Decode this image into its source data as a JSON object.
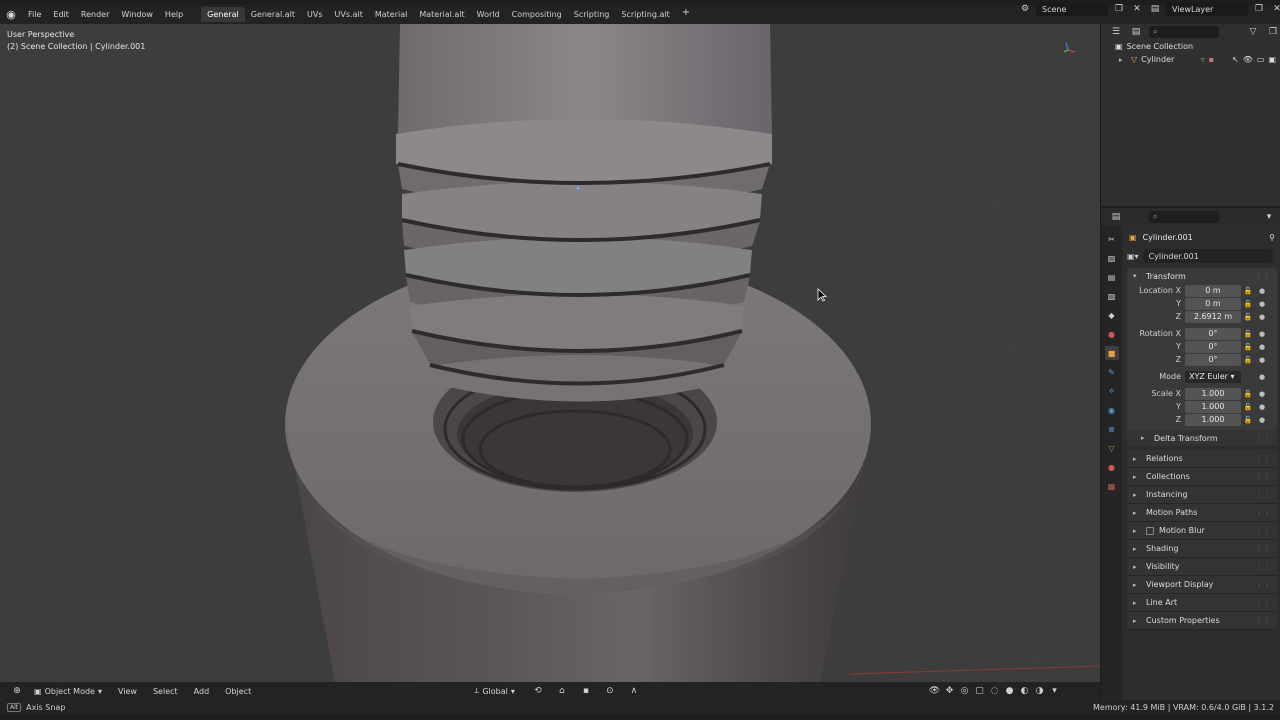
{
  "menu": [
    "File",
    "Edit",
    "Render",
    "Window",
    "Help"
  ],
  "tabs": [
    "General",
    "General.alt",
    "UVs",
    "UVs.alt",
    "Material",
    "Material.alt",
    "World",
    "Compositing",
    "Scripting",
    "Scripting.alt"
  ],
  "tab_add": "+",
  "scene": {
    "name": "Scene",
    "view_layer": "ViewLayer"
  },
  "viewport": {
    "perspective": "User Perspective",
    "collection": "(2) Scene Collection | Cylinder.001"
  },
  "footer": {
    "mode": "Object Mode",
    "menus": [
      "View",
      "Select",
      "Add",
      "Object"
    ],
    "orientation": "Global"
  },
  "status": {
    "key": "Alt",
    "hint": "Axis Snap",
    "memory": "Memory: 41.9 MiB | VRAM: 0.6/4.0 GiB | 3.1.2"
  },
  "outliner": {
    "collection": "Scene Collection",
    "object": "Cylinder"
  },
  "props": {
    "object_name": "Cylinder.001",
    "data_name": "Cylinder.001",
    "transform_title": "Transform",
    "location": {
      "label": "Location X",
      "x": "0 m",
      "y": "0 m",
      "z": "2.6912 m"
    },
    "rotation": {
      "label": "Rotation X",
      "x": "0°",
      "y": "0°",
      "z": "0°"
    },
    "mode": {
      "label": "Mode",
      "value": "XYZ Euler"
    },
    "scale": {
      "label": "Scale X",
      "x": "1.000",
      "y": "1.000",
      "z": "1.000"
    },
    "axis_y": "Y",
    "axis_z": "Z",
    "delta": "Delta Transform",
    "sections": [
      "Relations",
      "Collections",
      "Instancing",
      "Motion Paths",
      "Motion Blur",
      "Shading",
      "Visibility",
      "Viewport Display",
      "Line Art",
      "Custom Properties"
    ]
  }
}
